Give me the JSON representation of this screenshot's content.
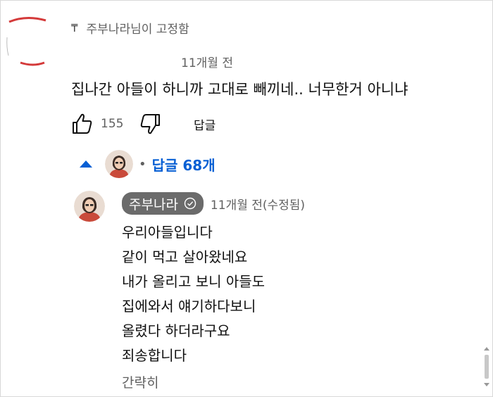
{
  "comment": {
    "pinned_label": "주부나라님이 고정함",
    "timestamp": "11개월 전",
    "text": "집나간 아들이 하니까 고대로 빼끼네.. 너무한거 아니냐",
    "like_count": "155",
    "reply_label": "답글",
    "replies_toggle_label": "답글 68개"
  },
  "reply": {
    "author": "주부나라",
    "timestamp": "11개월 전(수정됨)",
    "lines": [
      "우리아들입니다",
      "같이 먹고 살아왔네요",
      "내가 올리고 보니 아들도",
      "집에와서 얘기하다보니",
      "올렸다 하더라구요",
      "죄송합니다"
    ],
    "collapse_label": "간략히"
  },
  "icons": {
    "pin": "pin-icon",
    "like": "thumbs-up-icon",
    "dislike": "thumbs-down-icon",
    "collapse": "caret-up-icon",
    "verified": "verified-check-icon"
  },
  "colors": {
    "link_blue": "#065fd4",
    "secondary_text": "#606060",
    "author_pill": "#6b6b6b"
  }
}
